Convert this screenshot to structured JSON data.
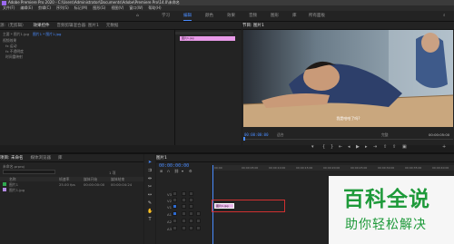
{
  "titlebar": {
    "text": "Adobe Premiere Pro 2020 - C:\\Users\\Administrator\\Documents\\Adobe\\Premiere Pro\\14.0\\未命名"
  },
  "menubar": [
    "文件(F)",
    "编辑(E)",
    "剪辑(C)",
    "序列(S)",
    "标记(M)",
    "图形(G)",
    "视图(V)",
    "窗口(W)",
    "帮助(H)"
  ],
  "workspaces": [
    {
      "label": "学习",
      "active": false
    },
    {
      "label": "编辑",
      "active": true
    },
    {
      "label": "颜色",
      "active": false
    },
    {
      "label": "效果",
      "active": false
    },
    {
      "label": "音频",
      "active": false
    },
    {
      "label": "图形",
      "active": false
    },
    {
      "label": "库",
      "active": false
    },
    {
      "label": "所有面板",
      "active": false
    }
  ],
  "source_panel": {
    "tabs": [
      "源:（无剪辑）",
      "效果控件",
      "音频剪辑混合器: 图片1",
      "元数据"
    ],
    "active_tab": 1,
    "header_left": "主要 * 图片1.jpg",
    "header_right": "图片1 * 图片1.jpg",
    "rows": [
      "视频效果",
      "fx 运动",
      "fx 不透明度",
      "时间重映射"
    ],
    "clip_label": "图片1.jpg"
  },
  "program_panel": {
    "title": "节目: 图片1",
    "subtitle": "我是哈哈了吗?",
    "timecode_in": "00:00:00:00",
    "fit": "适合",
    "quality": "完整",
    "timecode_out": "00:00:05:00"
  },
  "project_panel": {
    "title": "项目: 未命名",
    "tabs": [
      "项目: 未命名",
      "媒体浏览器",
      "库"
    ],
    "file": "未命名.prproj",
    "count": "1 项",
    "columns": [
      "名称",
      "帧速率",
      "媒体开始",
      "媒体结束"
    ],
    "rows": [
      {
        "name": "图片1",
        "fps": "25.00 fps",
        "start": "00:00:00:00",
        "end": "00:00:04:24"
      },
      {
        "name": "图片1.jpg",
        "fps": "",
        "start": "",
        "end": ""
      }
    ]
  },
  "timeline": {
    "tab": "图片1",
    "timecode": "00:00:00:00",
    "ruler": [
      "00:00",
      "00:00:05:00",
      "00:00:10:00",
      "00:00:15:00",
      "00:00:20:00",
      "00:00:25:00",
      "00:00:30:00",
      "00:00:35:00",
      "00:00:40:00"
    ],
    "tracks": [
      "V3",
      "V2",
      "V1",
      "A1",
      "A2",
      "A3"
    ],
    "clip_label": "图片1.jpg"
  },
  "watermark": {
    "title": "百科全说",
    "subtitle": "助你轻松解决"
  },
  "colors": {
    "accent": "#4a8cff",
    "clip_pink": "#e89ae8",
    "watermark_green": "#1e9a3a",
    "highlight_red": "#d03030"
  }
}
